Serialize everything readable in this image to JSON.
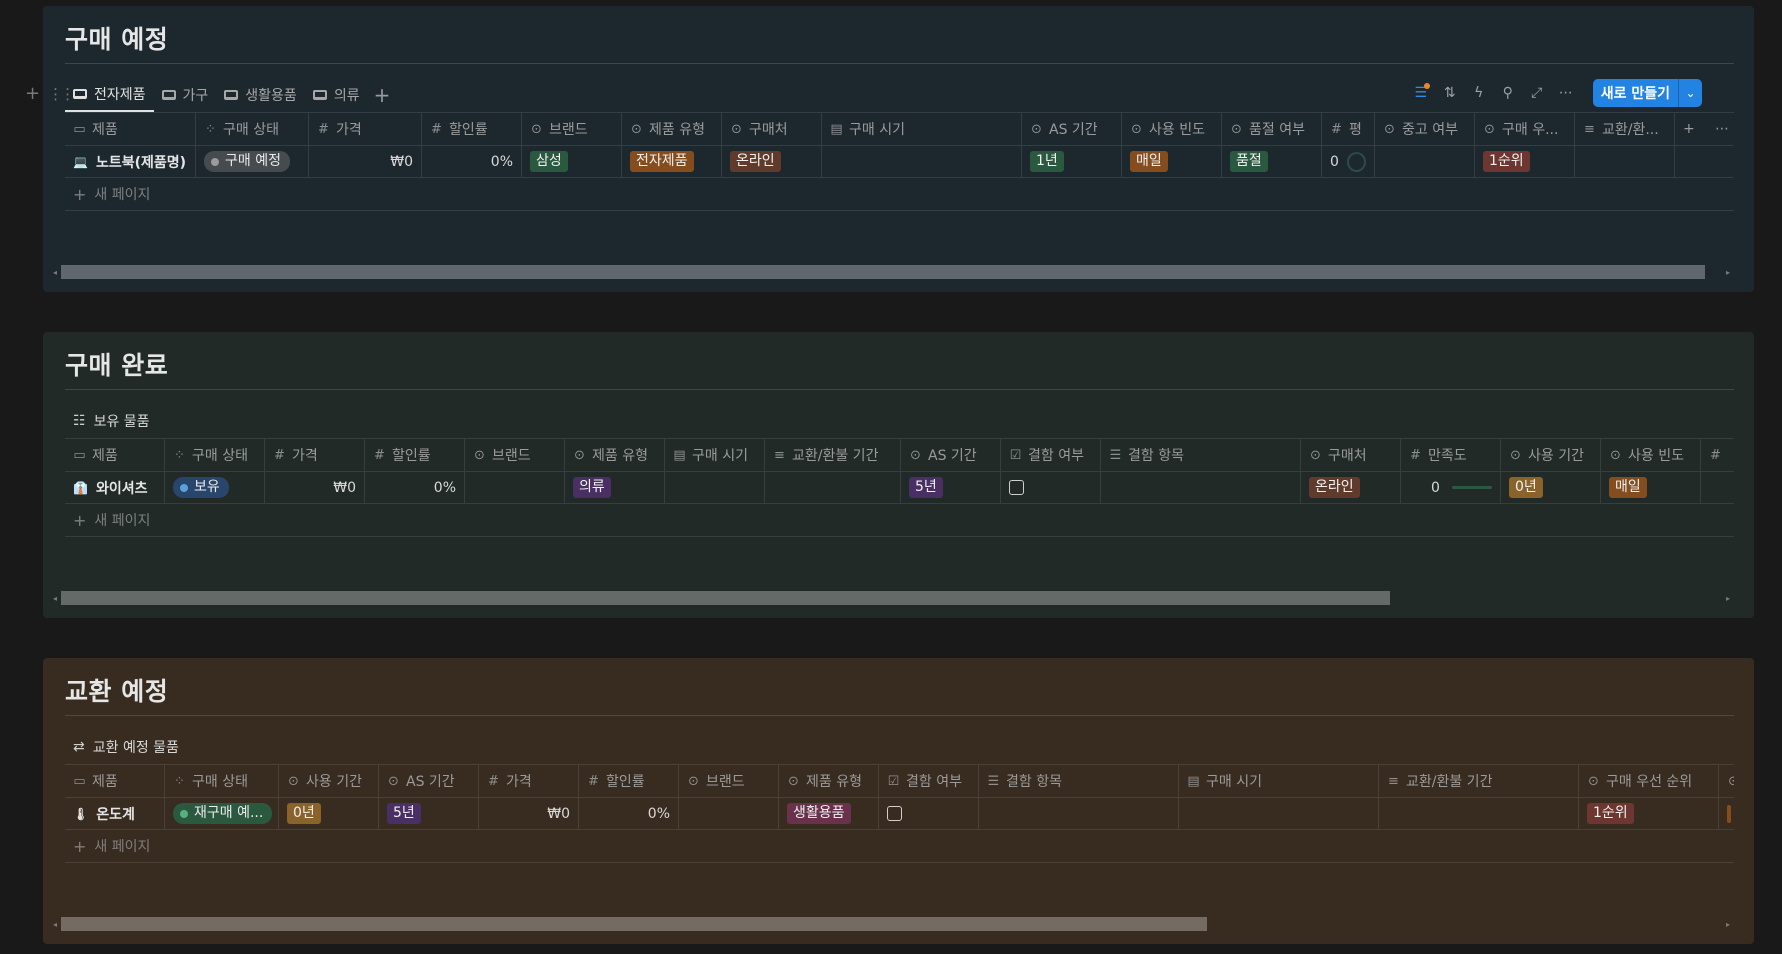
{
  "sections": {
    "planned": {
      "title": "구매 예정",
      "tabs": [
        "전자제품",
        "가구",
        "생활용품",
        "의류"
      ],
      "toolbar": {
        "new_label": "새로 만들기"
      },
      "columns": [
        "제품",
        "구매 상태",
        "가격",
        "할인률",
        "브랜드",
        "제품 유형",
        "구매처",
        "구매 시기",
        "AS 기간",
        "사용 빈도",
        "품절 여부",
        "평",
        "중고 여부",
        "구매 우...",
        "교환/환..."
      ],
      "row": {
        "title": "노트북(제품명)",
        "status": "구매 예정",
        "price": "₩0",
        "discount": "0%",
        "brand": "삼성",
        "type": "전자제품",
        "store": "온라인",
        "as_period": "1년",
        "frequency": "매일",
        "soldout": "품절",
        "rating": "0",
        "priority": "1순위"
      },
      "new_page": "새 페이지"
    },
    "completed": {
      "title": "구매 완료",
      "view": "보유 물품",
      "columns": [
        "제품",
        "구매 상태",
        "가격",
        "할인률",
        "브랜드",
        "제품 유형",
        "구매 시기",
        "교환/환불 기간",
        "AS 기간",
        "결함 여부",
        "결함 항목",
        "구매처",
        "만족도",
        "사용 기간",
        "사용 빈도"
      ],
      "row": {
        "title": "와이셔츠",
        "status": "보유",
        "price": "₩0",
        "discount": "0%",
        "type": "의류",
        "as_period": "5년",
        "store": "온라인",
        "satisfaction": "0",
        "use_period": "0년",
        "frequency": "매일"
      },
      "new_page": "새 페이지"
    },
    "exchange": {
      "title": "교환 예정",
      "view": "교환 예정 물품",
      "columns": [
        "제품",
        "구매 상태",
        "사용 기간",
        "AS 기간",
        "가격",
        "할인률",
        "브랜드",
        "제품 유형",
        "결함 여부",
        "결함 항목",
        "구매 시기",
        "교환/환불 기간",
        "구매 우선 순위"
      ],
      "row": {
        "title": "온도계",
        "status": "재구매 예...",
        "use_period": "0년",
        "as_period": "5년",
        "price": "₩0",
        "discount": "0%",
        "type": "생활용품",
        "priority": "1순위"
      },
      "new_page": "새 페이지"
    }
  },
  "colors": {
    "accent": "#2383e2",
    "planned_bg": "#1d282e",
    "completed_bg": "#212a26",
    "exchange_bg": "#382b1f"
  },
  "scroll": {
    "planned": 0.99,
    "completed": 0.8,
    "exchange": 0.69
  }
}
